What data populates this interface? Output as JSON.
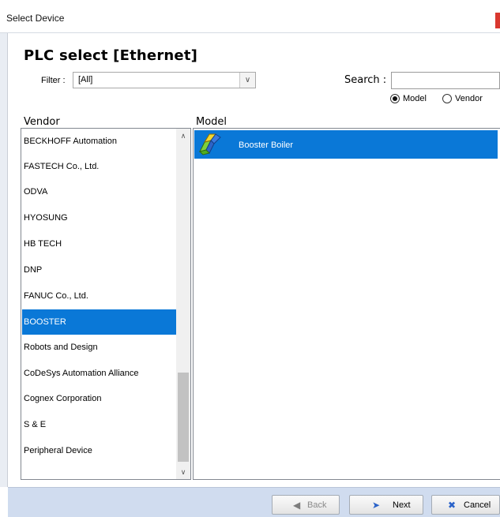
{
  "window": {
    "title": "Select Device"
  },
  "header": {
    "title": "PLC select [Ethernet]",
    "filter_label": "Filter :",
    "filter_value": "[All]",
    "search_label": "Search :",
    "search_value": "",
    "radio_model_label": "Model",
    "radio_vendor_label": "Vendor",
    "selected_radio": "Model"
  },
  "columns": {
    "vendor": "Vendor",
    "model": "Model"
  },
  "vendors": {
    "items": [
      "BECKHOFF Automation",
      "FASTECH Co., Ltd.",
      "ODVA",
      "HYOSUNG",
      "HB TECH",
      "DNP",
      "FANUC Co., Ltd.",
      "BOOSTER",
      "Robots and Design",
      "CoDeSys Automation Alliance",
      "Cognex Corporation",
      "S & E",
      "Peripheral Device"
    ],
    "selected": "BOOSTER"
  },
  "models": {
    "items": [
      {
        "label": "Booster Boiler",
        "icon": "plc-device-icon"
      }
    ],
    "selected": "Booster Boiler"
  },
  "footer": {
    "back_label": "Back",
    "next_label": "Next",
    "cancel_label": "Cancel"
  },
  "colors": {
    "selection": "#0a78d7",
    "footer": "#d0dcef",
    "close": "#d9382f"
  }
}
